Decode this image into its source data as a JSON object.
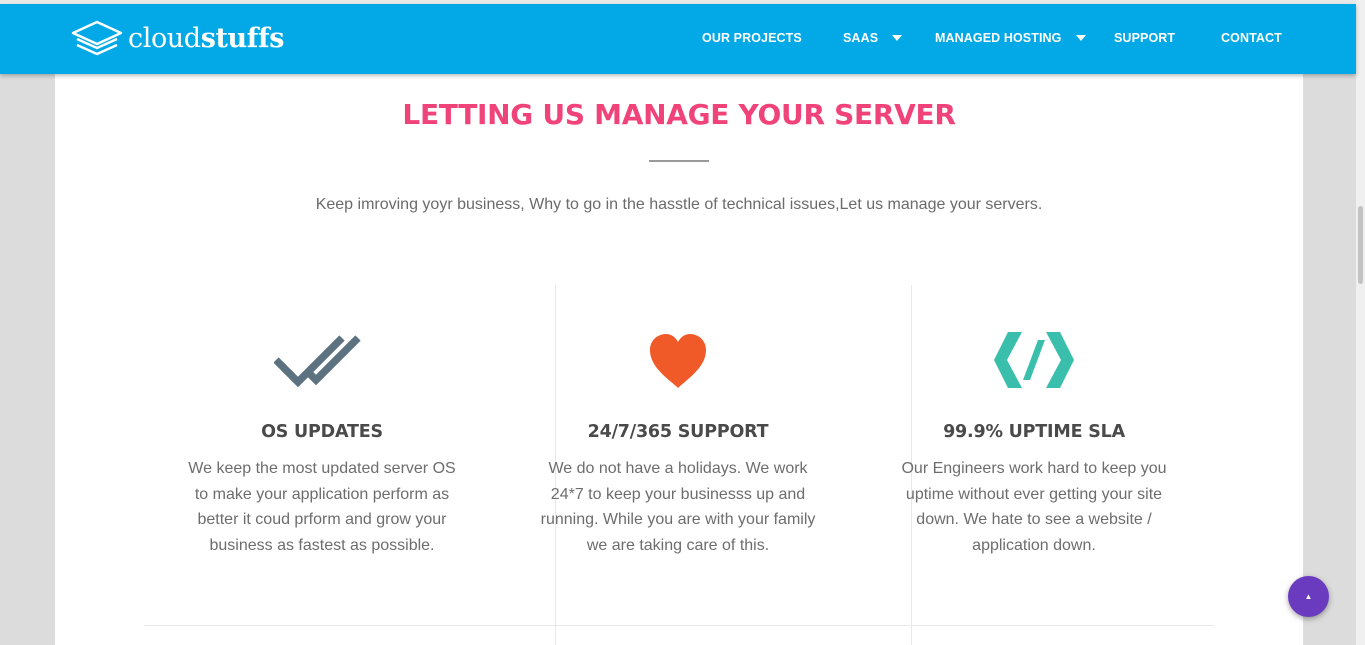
{
  "brand": {
    "name_light": "cloud",
    "name_bold": "stuffs",
    "logo_icon": "stacked-layers-icon"
  },
  "nav": {
    "items": [
      {
        "label": "OUR PROJECTS",
        "dropdown": false
      },
      {
        "label": "SAAS",
        "dropdown": true
      },
      {
        "label": "MANAGED HOSTING",
        "dropdown": true
      },
      {
        "label": "SUPPORT",
        "dropdown": false
      },
      {
        "label": "CONTACT",
        "dropdown": false
      }
    ]
  },
  "section": {
    "title": "LETTING US MANAGE YOUR SERVER",
    "subtitle": "Keep imroving yoyr business, Why to go in the hasstle of technical issues,Let us manage your servers."
  },
  "features": [
    {
      "icon": "double-check-icon",
      "title": "OS UPDATES",
      "text": "We keep the most updated server OS to make your application perform as better it coud prform and grow your business as fastest as possible."
    },
    {
      "icon": "heart-icon",
      "title": "24/7/365 SUPPORT",
      "text": "We do not have a holidays. We work 24*7 to keep your businesss up and running. While you are with your family we are taking care of this."
    },
    {
      "icon": "code-brackets-icon",
      "title": "99.9% UPTIME SLA",
      "text": "Our Engineers work hard to keep you uptime without ever getting your site down. We hate to see a website / application down."
    }
  ],
  "colors": {
    "header": "#03a9e6",
    "title_accent": "#f0437a",
    "check_icon": "#5d7280",
    "heart_icon": "#f05a28",
    "code_icon": "#3bbfad",
    "scroll_top_button": "#6a3bbf"
  },
  "scroll_top": {
    "icon": "arrow-up-icon",
    "glyph": "▲"
  }
}
